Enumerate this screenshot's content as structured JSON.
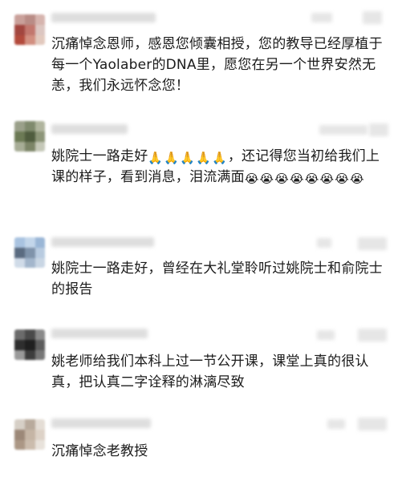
{
  "comments": [
    {
      "text": "沉痛悼念恩师，感恩您倾囊相授，您的教导已经厚植于每一个Yaolaber的DNA里，愿您在另一个世界安然无恙，我们永远怀念您！",
      "avatar_colors": [
        "#c9a09a",
        "#b98c86",
        "#d6b4ae",
        "#a2463f",
        "#c2776e",
        "#dcc6c1",
        "#b34a3c",
        "#d28f80",
        "#e2c9be"
      ]
    },
    {
      "text_before_emoji": "姚院士一路走好",
      "emoji_folded_hands": [
        "🙏",
        "🙏",
        "🙏",
        "🙏",
        "🙏"
      ],
      "text_after_emoji": "，还记得您当初给我们上课的样子，看到消息，泪流满面",
      "emoji_crying": [
        "😭",
        "😭",
        "😭",
        "😭",
        "😭",
        "😭",
        "😭",
        "😭"
      ],
      "avatar_colors": [
        "#9aa08a",
        "#7f8a6d",
        "#b0b59e",
        "#6c7a55",
        "#4f5c3e",
        "#8d9679",
        "#a7ad96",
        "#7c8567",
        "#c5c8b8"
      ]
    },
    {
      "text": "姚院士一路走好，曾经在大礼堂聆听过姚院士和俞院士的报告",
      "avatar_colors": [
        "#a9c3e0",
        "#c3d6ea",
        "#9ab6d6",
        "#5a6b80",
        "#7f93aa",
        "#b8cbe0",
        "#d0dbe8",
        "#a3b6cc",
        "#c9d6e4"
      ]
    },
    {
      "text": "姚老师给我们本科上过一节公开课，课堂上真的很认真，把认真二字诠释的淋漓尽致",
      "avatar_colors": [
        "#6b6b6b",
        "#4a4a4a",
        "#8a8a8a",
        "#2e2e2e",
        "#1f1f1f",
        "#5c5c5c",
        "#9a9a9a",
        "#3d3d3d",
        "#777777"
      ]
    },
    {
      "text": "沉痛悼念老教授",
      "avatar_colors": [
        "#d6cfc6",
        "#b8aa9c",
        "#e4ddd5",
        "#9c8878",
        "#c5b5a5",
        "#ddd2c7",
        "#ab9785",
        "#cbbcad",
        "#e8e2db"
      ]
    }
  ]
}
